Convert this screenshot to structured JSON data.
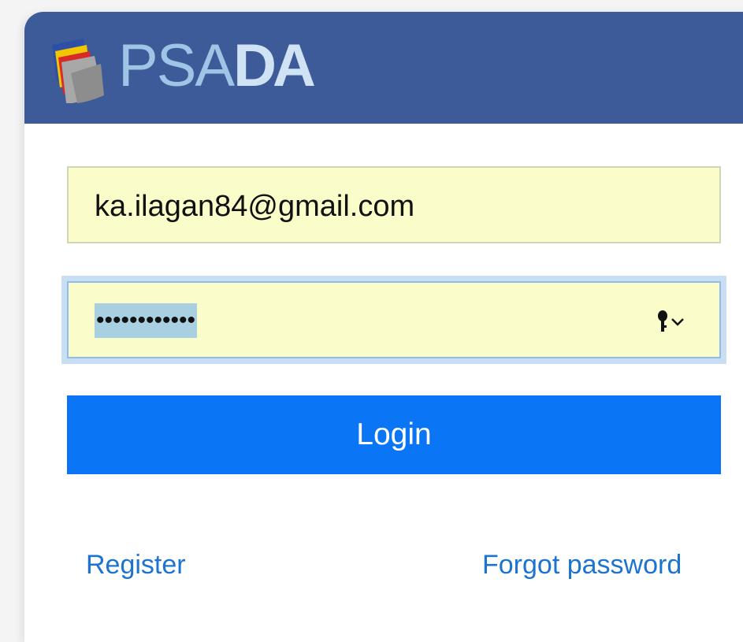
{
  "brand": {
    "name_light": "PSA",
    "name_bold": "DA",
    "logo_icon": "folder-files-icon",
    "header_color": "#3d5a99"
  },
  "login_form": {
    "email_value": "ka.ilagan84@gmail.com",
    "password_value": "••••••••••••",
    "password_key_icon": "key-icon",
    "password_dropdown_icon": "chevron-down-icon",
    "autofill_color": "#fafdc9",
    "login_label": "Login",
    "login_color": "#0a76f6"
  },
  "links": {
    "register_label": "Register",
    "forgot_password_label": "Forgot password",
    "link_color": "#1d73d0"
  }
}
